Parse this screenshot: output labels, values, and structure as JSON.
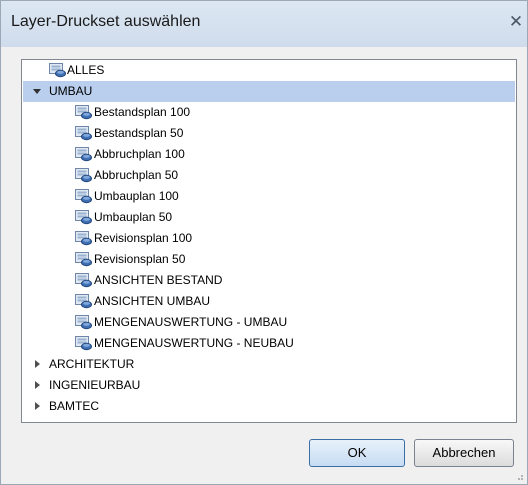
{
  "window": {
    "title": "Layer-Druckset auswählen",
    "close_label": "✕"
  },
  "tree": {
    "rows": [
      {
        "label": "ALLES",
        "level": 1,
        "kind": "leaf",
        "icon": "layer-set-icon"
      },
      {
        "label": "UMBAU",
        "level": 0,
        "kind": "expanded",
        "selected": true
      },
      {
        "label": "Bestandsplan 100",
        "level": 2,
        "kind": "leaf",
        "icon": "layer-set-icon"
      },
      {
        "label": "Bestandsplan 50",
        "level": 2,
        "kind": "leaf",
        "icon": "layer-set-icon"
      },
      {
        "label": "Abbruchplan 100",
        "level": 2,
        "kind": "leaf",
        "icon": "layer-set-icon"
      },
      {
        "label": "Abbruchplan 50",
        "level": 2,
        "kind": "leaf",
        "icon": "layer-set-icon"
      },
      {
        "label": "Umbauplan 100",
        "level": 2,
        "kind": "leaf",
        "icon": "layer-set-icon"
      },
      {
        "label": "Umbauplan 50",
        "level": 2,
        "kind": "leaf",
        "icon": "layer-set-icon"
      },
      {
        "label": "Revisionsplan 100",
        "level": 2,
        "kind": "leaf",
        "icon": "layer-set-icon"
      },
      {
        "label": "Revisionsplan 50",
        "level": 2,
        "kind": "leaf",
        "icon": "layer-set-icon"
      },
      {
        "label": "ANSICHTEN BESTAND",
        "level": 2,
        "kind": "leaf",
        "icon": "layer-set-icon"
      },
      {
        "label": "ANSICHTEN UMBAU",
        "level": 2,
        "kind": "leaf",
        "icon": "layer-set-icon"
      },
      {
        "label": "MENGENAUSWERTUNG - UMBAU",
        "level": 2,
        "kind": "leaf",
        "icon": "layer-set-icon"
      },
      {
        "label": "MENGENAUSWERTUNG - NEUBAU",
        "level": 2,
        "kind": "leaf",
        "icon": "layer-set-icon"
      },
      {
        "label": "ARCHITEKTUR",
        "level": 0,
        "kind": "collapsed"
      },
      {
        "label": "INGENIEURBAU",
        "level": 0,
        "kind": "collapsed"
      },
      {
        "label": "BAMTEC",
        "level": 0,
        "kind": "collapsed"
      }
    ]
  },
  "buttons": {
    "ok": "OK",
    "cancel": "Abbrechen"
  },
  "colors": {
    "selection": "#b9cfed",
    "titlebar": "#d6e2f0",
    "dialog_bg": "#f0f0f0"
  }
}
